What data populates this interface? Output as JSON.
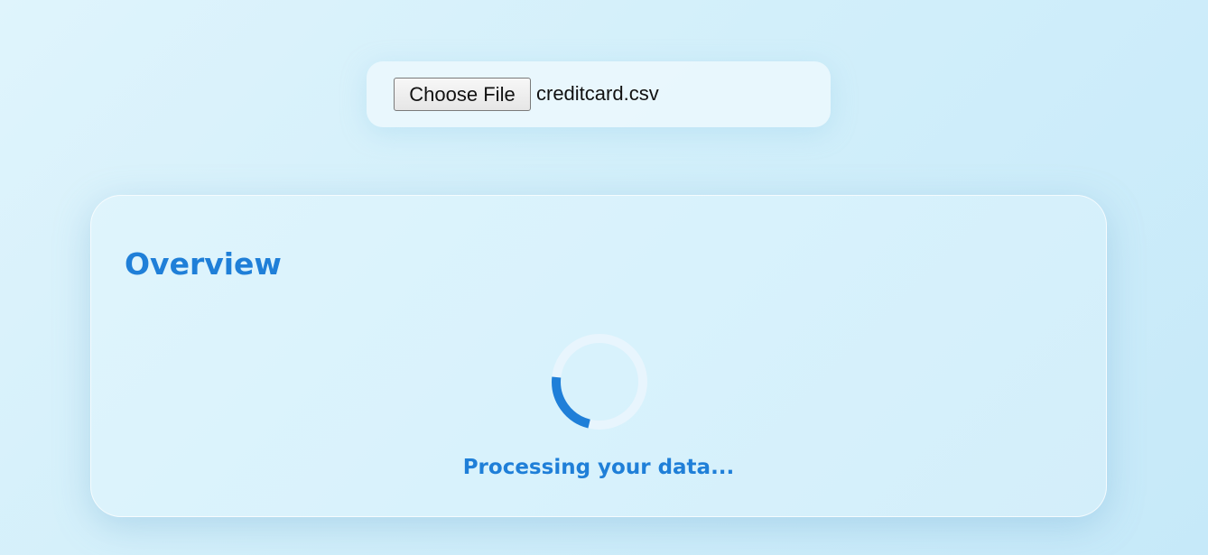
{
  "upload": {
    "button_label": "Choose File",
    "file_name": "creditcard.csv"
  },
  "overview": {
    "title": "Overview",
    "status_text": "Processing your data..."
  },
  "colors": {
    "accent": "#1f7fd8",
    "spinner_track": "#e8f5fd"
  },
  "icons": {
    "spinner": "loading-spinner-icon"
  }
}
